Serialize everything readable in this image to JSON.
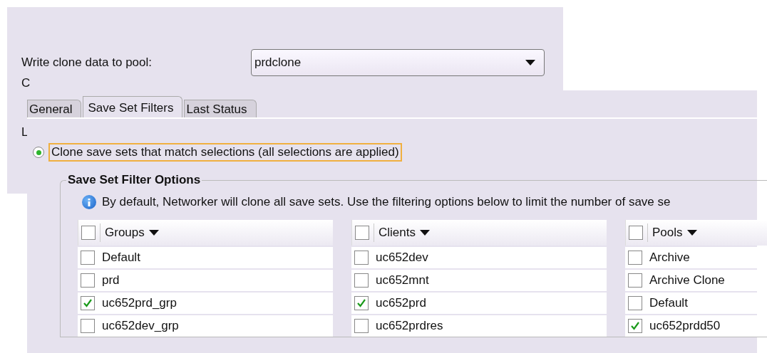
{
  "back_window": {
    "pool_label": "Write clone data to pool:",
    "pool_dropdown": {
      "value": "prdclone"
    },
    "fragments": [
      "C",
      "L"
    ]
  },
  "front_window": {
    "tabs": [
      {
        "label": "General",
        "selected": false
      },
      {
        "label": "Save Set Filters",
        "selected": true
      },
      {
        "label": "Last Status",
        "selected": false
      }
    ],
    "clone_option": {
      "label": "Clone save sets that match selections (all selections are applied)",
      "selected": true
    },
    "filter_options": {
      "title": "Save Set Filter Options",
      "info": "By default, Networker will clone all save sets. Use the filtering options below to limit the number of save se",
      "lists": [
        {
          "header": "Groups",
          "checked": false,
          "items": [
            {
              "label": "Default",
              "checked": false
            },
            {
              "label": "prd",
              "checked": false
            },
            {
              "label": "uc652prd_grp",
              "checked": true
            },
            {
              "label": "uc652dev_grp",
              "checked": false
            }
          ]
        },
        {
          "header": "Clients",
          "checked": false,
          "items": [
            {
              "label": "uc652dev",
              "checked": false
            },
            {
              "label": "uc652mnt",
              "checked": false
            },
            {
              "label": "uc652prd",
              "checked": true
            },
            {
              "label": "uc652prdres",
              "checked": false
            }
          ]
        },
        {
          "header": "Pools",
          "checked": false,
          "items": [
            {
              "label": "Archive",
              "checked": false
            },
            {
              "label": "Archive Clone",
              "checked": false
            },
            {
              "label": "Default",
              "checked": false
            },
            {
              "label": "uc652prdd50",
              "checked": true
            }
          ]
        }
      ]
    }
  }
}
